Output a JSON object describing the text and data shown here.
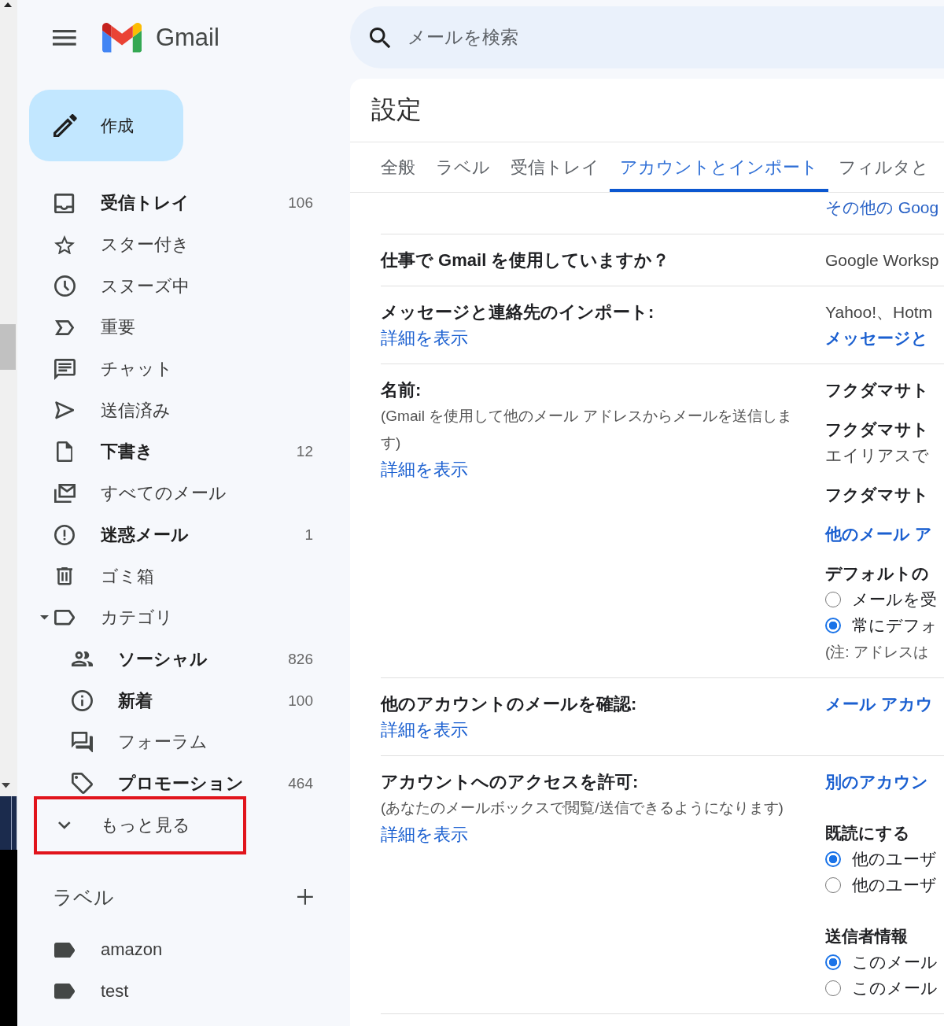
{
  "app": {
    "name": "Gmail"
  },
  "compose": {
    "label": "作成"
  },
  "sidebar": {
    "items": [
      {
        "label": "受信トレイ",
        "count": "106",
        "unread": true
      },
      {
        "label": "スター付き",
        "unread": false
      },
      {
        "label": "スヌーズ中",
        "unread": false
      },
      {
        "label": "重要",
        "unread": false
      },
      {
        "label": "チャット",
        "unread": false
      },
      {
        "label": "送信済み",
        "unread": false
      },
      {
        "label": "下書き",
        "count": "12",
        "unread": true
      },
      {
        "label": "すべてのメール",
        "unread": false
      },
      {
        "label": "迷惑メール",
        "count": "1",
        "unread": true
      },
      {
        "label": "ゴミ箱",
        "unread": false
      },
      {
        "label": "カテゴリ",
        "unread": false,
        "expanded": true,
        "children": [
          {
            "label": "ソーシャル",
            "count": "826",
            "unread": true
          },
          {
            "label": "新着",
            "count": "100",
            "unread": true
          },
          {
            "label": "フォーラム",
            "unread": false
          },
          {
            "label": "プロモーション",
            "count": "464",
            "unread": true
          }
        ]
      },
      {
        "label": "もっと見る",
        "highlighted": true
      }
    ]
  },
  "labels": {
    "title": "ラベル",
    "items": [
      {
        "label": "amazon"
      },
      {
        "label": "test"
      }
    ]
  },
  "search": {
    "placeholder": "メールを検索"
  },
  "settings": {
    "title": "設定",
    "tabs": [
      {
        "label": "全般",
        "selected": false
      },
      {
        "label": "ラベル",
        "selected": false
      },
      {
        "label": "受信トレイ",
        "selected": false
      },
      {
        "label": "アカウントとインポート",
        "selected": true
      },
      {
        "label": "フィルタと",
        "selected": false
      }
    ],
    "scrolled_row": {
      "link": "その他の Goog"
    },
    "rows": [
      {
        "label": "仕事で Gmail を使用していますか？",
        "details": [
          [
            {
              "kind": "text",
              "text": "Google Worksp"
            }
          ]
        ]
      },
      {
        "label": "メッセージと連絡先のインポート:",
        "link": "詳細を表示",
        "details": [
          [
            {
              "kind": "text",
              "text": "Yahoo!、Hotm"
            },
            {
              "kind": "link",
              "text": "メッセージと"
            }
          ]
        ]
      },
      {
        "label": "名前:",
        "note": "(Gmail を使用して他のメール アドレスからメールを送信します)",
        "link": "詳細を表示",
        "details": [
          [
            {
              "kind": "strong",
              "text": "フクダマサト"
            }
          ],
          [
            {
              "kind": "strong",
              "text": "フクダマサト"
            },
            {
              "kind": "text",
              "text": "エイリアスで"
            }
          ],
          [
            {
              "kind": "strong",
              "text": "フクダマサト"
            }
          ],
          [
            {
              "kind": "link",
              "text": "他のメール ア"
            }
          ],
          [
            {
              "kind": "strong",
              "text": "デフォルトの"
            },
            {
              "kind": "radio",
              "text": "メールを受",
              "selected": false
            },
            {
              "kind": "radio",
              "text": "常にデフォ",
              "selected": true
            },
            {
              "kind": "note",
              "text": "(注: アドレスは"
            }
          ]
        ]
      },
      {
        "label": "他のアカウントのメールを確認:",
        "link": "詳細を表示",
        "details": [
          [
            {
              "kind": "link",
              "text": "メール アカウ"
            }
          ]
        ]
      },
      {
        "label": "アカウントへのアクセスを許可:",
        "note": "(あなたのメールボックスで閲覧/送信できるようになります)",
        "link": "詳細を表示",
        "details": [
          [
            {
              "kind": "link",
              "text": "別のアカウン"
            }
          ],
          [
            {
              "kind": "strong",
              "text": "既読にする"
            },
            {
              "kind": "radio",
              "text": "他のユーザ",
              "selected": true
            },
            {
              "kind": "radio",
              "text": "他のユーザ",
              "selected": false
            }
          ],
          [
            {
              "kind": "strong",
              "text": "送信者情報"
            },
            {
              "kind": "radio",
              "text": "このメール",
              "selected": true
            },
            {
              "kind": "radio",
              "text": "このメール",
              "selected": false
            }
          ]
        ]
      }
    ]
  }
}
